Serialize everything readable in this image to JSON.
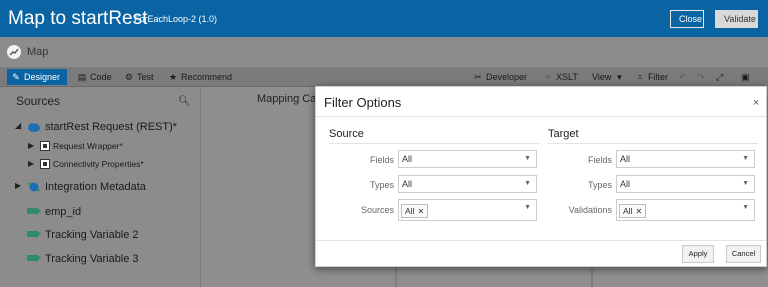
{
  "header": {
    "title": "Map to startRest",
    "subtitle": "ForEachLoop-2 (1.0)",
    "close_label": "Close",
    "validate_label": "Validate"
  },
  "map_row": {
    "label": "Map"
  },
  "toolbar": {
    "designer": "Designer",
    "code": "Code",
    "test": "Test",
    "recommend": "Recommend",
    "developer": "Developer",
    "xslt": "XSLT",
    "view": "View",
    "filter": "Filter"
  },
  "sources": {
    "heading": "Sources",
    "items": [
      {
        "label": "startRest Request (REST)",
        "marker": "*"
      },
      {
        "label": "Request Wrapper",
        "marker": "*"
      },
      {
        "label": "Connectivity Properties",
        "marker": "*"
      },
      {
        "label": "Integration Metadata"
      },
      {
        "label": "emp_id"
      },
      {
        "label": "Tracking Variable 2"
      },
      {
        "label": "Tracking Variable 3"
      }
    ]
  },
  "canvas": {
    "caption": "Mapping Ca"
  },
  "dialog": {
    "title": "Filter Options",
    "close_glyph": "×",
    "source": {
      "heading": "Source",
      "fields_label": "Fields",
      "fields_value": "All",
      "types_label": "Types",
      "types_value": "All",
      "sources_label": "Sources",
      "sources_chip": "All"
    },
    "target": {
      "heading": "Target",
      "fields_label": "Fields",
      "fields_value": "All",
      "types_label": "Types",
      "types_value": "All",
      "validations_label": "Validations",
      "validations_chip": "All"
    },
    "apply_label": "Apply",
    "cancel_label": "Cancel"
  },
  "colors": {
    "header_bg": "#0a64a4",
    "designer_tab_bg": "#0a64a4",
    "overlay_dim": "#8c8c8c",
    "tree_icon_teal": "#2f8a6a",
    "tree_icon_blue": "#1d6fb5"
  }
}
